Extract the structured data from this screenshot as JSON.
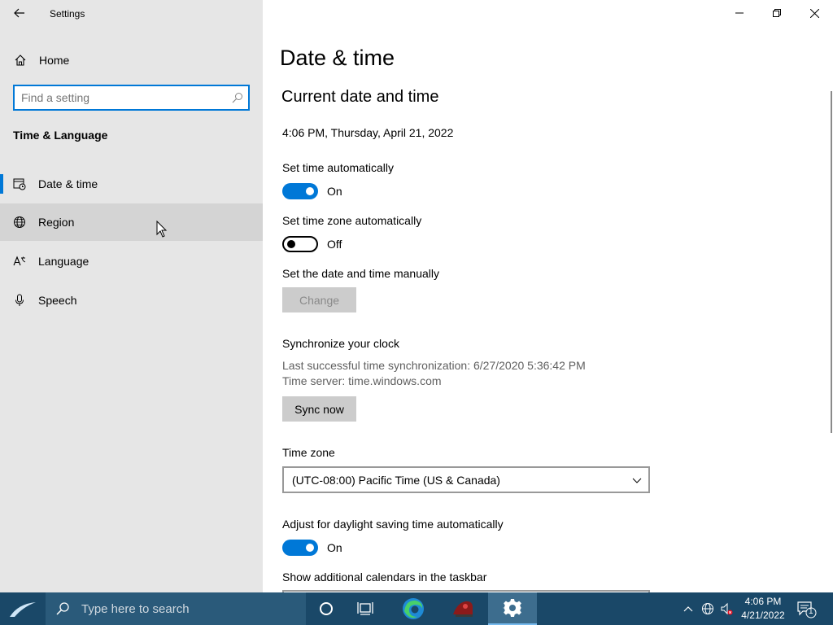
{
  "app": {
    "title": "Settings"
  },
  "sidebar": {
    "home_label": "Home",
    "search_placeholder": "Find a setting",
    "section_title": "Time & Language",
    "items": [
      {
        "label": "Date & time",
        "icon": "date-time-icon",
        "selected": true
      },
      {
        "label": "Region",
        "icon": "region-icon",
        "hovered": true
      },
      {
        "label": "Language",
        "icon": "language-icon"
      },
      {
        "label": "Speech",
        "icon": "microphone-icon"
      }
    ]
  },
  "main": {
    "page_title": "Date & time",
    "current_heading": "Current date and time",
    "current_datetime": "4:06 PM, Thursday, April 21, 2022",
    "set_time_auto": {
      "label": "Set time automatically",
      "state": "On"
    },
    "set_tz_auto": {
      "label": "Set time zone automatically",
      "state": "Off"
    },
    "manual": {
      "label": "Set the date and time manually",
      "button": "Change"
    },
    "sync": {
      "label": "Synchronize your clock",
      "last_sync": "Last successful time synchronization: 6/27/2020 5:36:42 PM",
      "server": "Time server: time.windows.com",
      "button": "Sync now"
    },
    "timezone": {
      "label": "Time zone",
      "value": "(UTC-08:00) Pacific Time (US & Canada)"
    },
    "dst": {
      "label": "Adjust for daylight saving time automatically",
      "state": "On"
    },
    "calendars": {
      "label": "Show additional calendars in the taskbar"
    }
  },
  "taskbar": {
    "search_placeholder": "Type here to search",
    "clock_time": "4:06 PM",
    "clock_date": "4/21/2022",
    "notification_count": "1"
  },
  "colors": {
    "accent": "#0078d7",
    "taskbar": "#1a4868",
    "sidebar": "#e6e6e6"
  }
}
